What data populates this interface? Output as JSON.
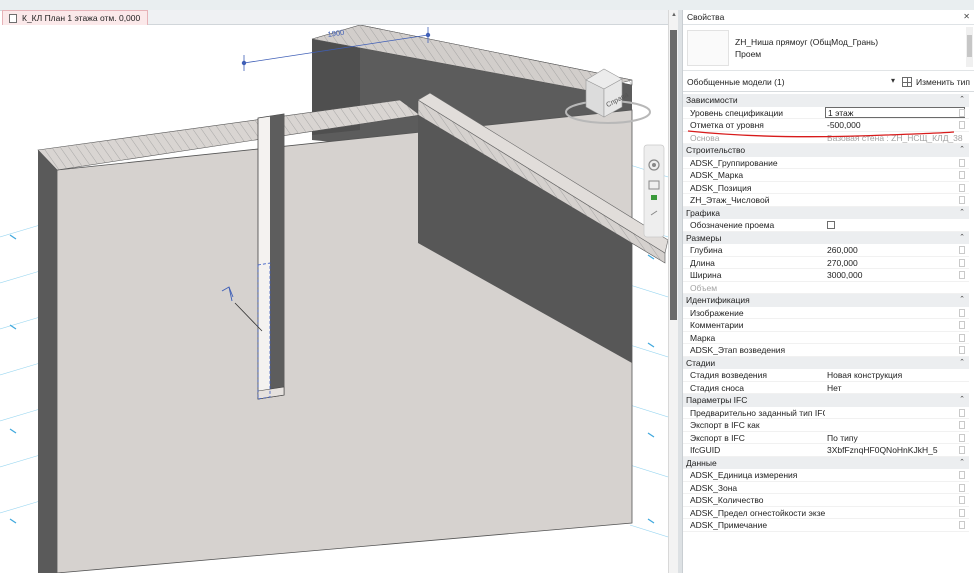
{
  "view_tab": {
    "title": "К_КЛ План 1 этажа отм. 0,000"
  },
  "viewport": {
    "dimension_label": "1900",
    "viewcube_label": "Справа"
  },
  "properties": {
    "title": "Свойства",
    "close_glyph": "✕",
    "type_name": "ZH_Ниша прямоуг (ОбщМод_Грань)",
    "type_sub": "Проем",
    "selector_value": "Обобщенные модели (1)",
    "edit_type_label": "Изменить тип",
    "groups": [
      {
        "name": "Зависимости",
        "rows": [
          {
            "k": "Уровень спецификации",
            "v": "1 этаж",
            "boxed": true
          },
          {
            "k": "Отметка от уровня",
            "v": "-500,000"
          },
          {
            "k": "Основа",
            "v": "Базовая стена : ZH_НСЩ_КЛД_380...",
            "dim": true
          }
        ]
      },
      {
        "name": "Строительство",
        "rows": [
          {
            "k": "ADSK_Группирование",
            "v": ""
          },
          {
            "k": "ADSK_Марка",
            "v": ""
          },
          {
            "k": "ADSK_Позиция",
            "v": ""
          },
          {
            "k": "ZH_Этаж_Числовой",
            "v": ""
          }
        ]
      },
      {
        "name": "Графика",
        "rows": [
          {
            "k": "Обозначение проема",
            "v": "",
            "checkbox": true
          }
        ]
      },
      {
        "name": "Размеры",
        "rows": [
          {
            "k": "Глубина",
            "v": "260,000"
          },
          {
            "k": "Длина",
            "v": "270,000"
          },
          {
            "k": "Ширина",
            "v": "3000,000"
          },
          {
            "k": "Объем",
            "v": "",
            "dim": true
          }
        ]
      },
      {
        "name": "Идентификация",
        "rows": [
          {
            "k": "Изображение",
            "v": ""
          },
          {
            "k": "Комментарии",
            "v": ""
          },
          {
            "k": "Марка",
            "v": ""
          },
          {
            "k": "ADSK_Этап возведения",
            "v": ""
          }
        ]
      },
      {
        "name": "Стадии",
        "rows": [
          {
            "k": "Стадия возведения",
            "v": "Новая конструкция"
          },
          {
            "k": "Стадия сноса",
            "v": "Нет"
          }
        ]
      },
      {
        "name": "Параметры IFC",
        "rows": [
          {
            "k": "Предварительно заданный тип IFC",
            "v": ""
          },
          {
            "k": "Экспорт в IFC как",
            "v": ""
          },
          {
            "k": "Экспорт в IFC",
            "v": "По типу"
          },
          {
            "k": "IfcGUID",
            "v": "3XbfFznqHF0QNoHnKJkH_5"
          }
        ]
      },
      {
        "name": "Данные",
        "rows": [
          {
            "k": "ADSK_Единица измерения",
            "v": ""
          },
          {
            "k": "ADSK_Зона",
            "v": ""
          },
          {
            "k": "ADSK_Количество",
            "v": ""
          },
          {
            "k": "ADSK_Предел огнестойкости экзе...",
            "v": ""
          },
          {
            "k": "ADSK_Примечание",
            "v": ""
          }
        ]
      }
    ]
  },
  "colors": {
    "accent_tab": "#fbe9ea",
    "annotation_blue": "#3f5fb7",
    "markup_red": "#d81b1b"
  }
}
